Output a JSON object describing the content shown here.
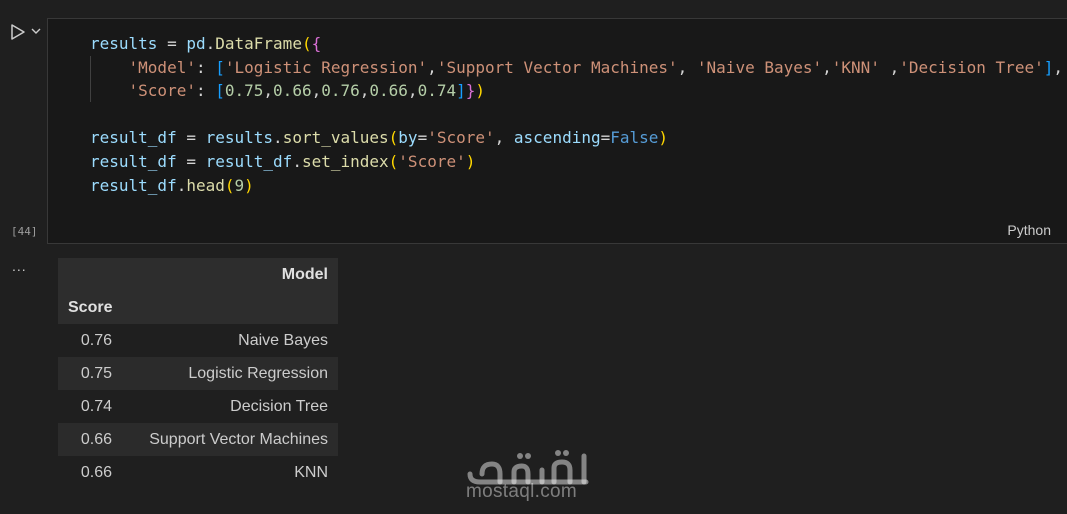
{
  "cell": {
    "execution_count": "[44]",
    "language": "Python",
    "code": {
      "l1": {
        "var": "results",
        "eq": " = ",
        "mod": "pd",
        "dot": ".",
        "fn": "DataFrame",
        "open1": "(",
        "open2": "{"
      },
      "l2": {
        "key": "'Model'",
        "colon": ": ",
        "open": "[",
        "s1": "'Logistic Regression'",
        "c1": ",",
        "s2": "'Support Vector Machines'",
        "c2": ", ",
        "s3": "'Naive Bayes'",
        "c3": ",",
        "s4": "'KNN'",
        "c4": " ,",
        "s5": "'Decision Tree'",
        "close": "]",
        "tail": ","
      },
      "l3": {
        "key": "'Score'",
        "colon": ": ",
        "open": "[",
        "nums": [
          "0.75",
          "0.66",
          "0.76",
          "0.66",
          "0.74"
        ],
        "close": "]",
        "close2": "}",
        "close1": ")"
      },
      "l5": {
        "var": "result_df",
        "eq": " = ",
        "obj": "results",
        "dot": ".",
        "fn": "sort_values",
        "open": "(",
        "p1": "by",
        "eq2": "=",
        "s1": "'Score'",
        "comma": ", ",
        "p2": "ascending",
        "eq3": "=",
        "kw": "False",
        "close": ")"
      },
      "l6": {
        "var": "result_df",
        "eq": " = ",
        "obj": "result_df",
        "dot": ".",
        "fn": "set_index",
        "open": "(",
        "s1": "'Score'",
        "close": ")"
      },
      "l7": {
        "obj": "result_df",
        "dot": ".",
        "fn": "head",
        "open": "(",
        "num": "9",
        "close": ")"
      }
    }
  },
  "output": {
    "more_label": "...",
    "columns_header": "Model",
    "index_name": "Score",
    "rows": [
      {
        "score": "0.76",
        "model": "Naive Bayes"
      },
      {
        "score": "0.75",
        "model": "Logistic Regression"
      },
      {
        "score": "0.74",
        "model": "Decision Tree"
      },
      {
        "score": "0.66",
        "model": "Support Vector Machines"
      },
      {
        "score": "0.66",
        "model": "KNN"
      }
    ]
  },
  "watermark": {
    "text": "mostaql.com",
    "arabic": "مستقل"
  },
  "colors": {
    "background": "#1f1f1f",
    "cell_background": "#181818",
    "variable": "#9cdcfe",
    "function": "#dcdcaa",
    "string": "#ce9178",
    "number": "#b5cea8",
    "keyword": "#569cd6",
    "bracket_1": "#ffd700",
    "bracket_2": "#da70d6",
    "bracket_3": "#179fff"
  },
  "icons": {
    "run": "play-icon",
    "run_menu": "chevron-down-icon"
  }
}
